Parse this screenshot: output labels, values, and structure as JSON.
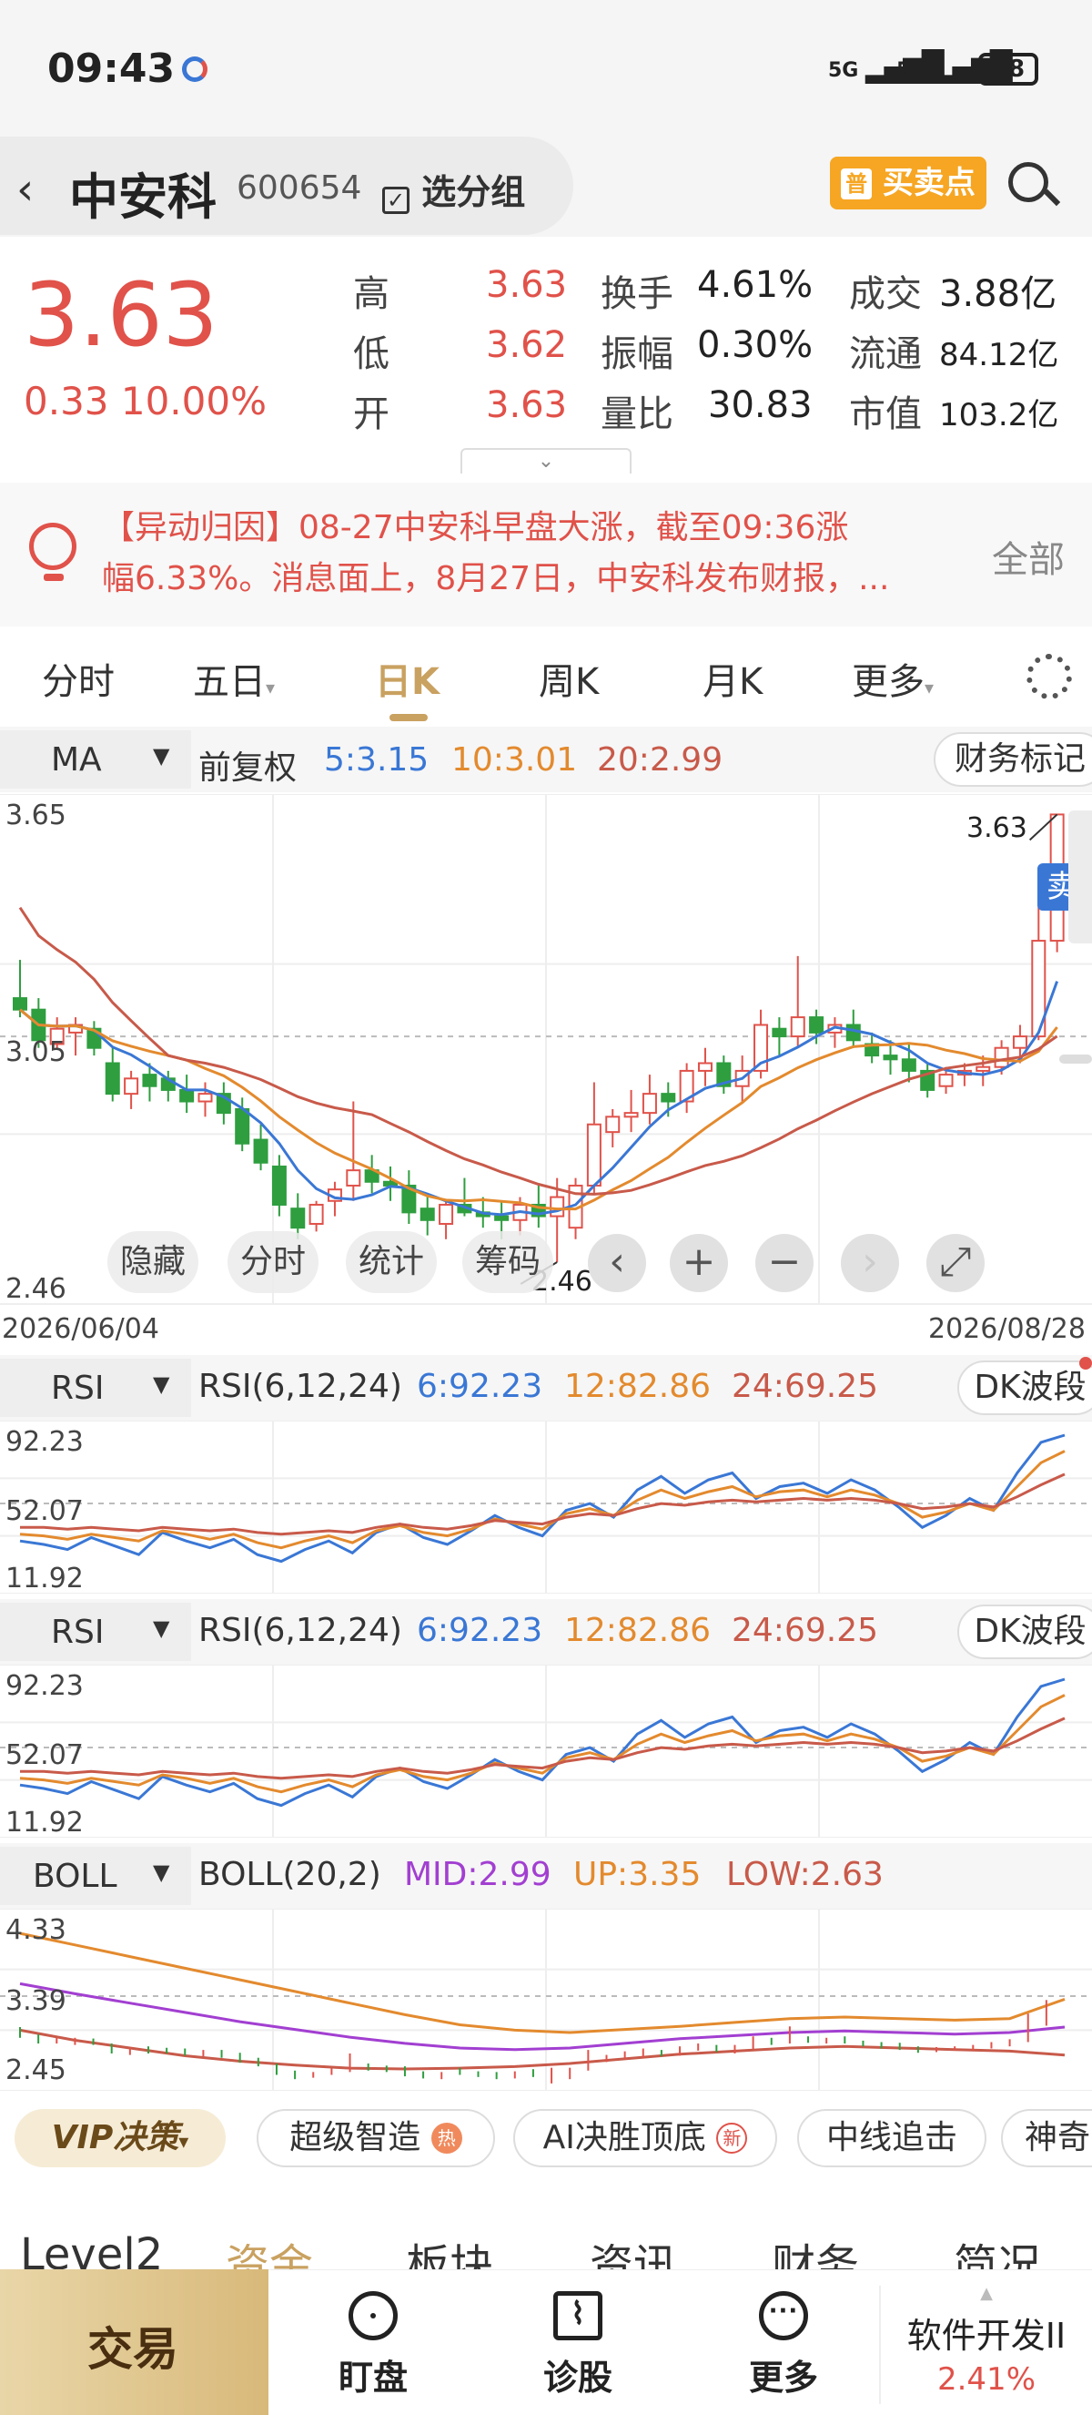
{
  "status": {
    "time": "09:43",
    "signal1": "5G",
    "signal2": "5G",
    "battery": "88"
  },
  "header": {
    "stock_name": "中安科",
    "stock_code": "600654",
    "group_button": "选分组",
    "buy_sell_button": "买卖点"
  },
  "quote": {
    "price": "3.63",
    "change": "0.33 10.00%",
    "rows": [
      {
        "l1": "高",
        "v1": "3.63",
        "l2": "换手",
        "v2": "4.61%",
        "l3": "成交",
        "v3": "3.88亿"
      },
      {
        "l1": "低",
        "v1": "3.62",
        "l2": "振幅",
        "v2": "0.30%",
        "l3": "流通",
        "v3": "84.12亿"
      },
      {
        "l1": "开",
        "v1": "3.63",
        "l2": "量比",
        "v2": "30.83",
        "l3": "市值",
        "v3": "103.2亿"
      }
    ]
  },
  "news": {
    "line1": "【异动归因】08-27中安科早盘大涨，截至09:36涨",
    "line2": "幅6.33%。消息面上，8月27日，中安科发布财报，...",
    "all": "全部"
  },
  "tabs": [
    "分时",
    "五日",
    "日K",
    "周K",
    "月K",
    "更多"
  ],
  "kline": {
    "indicator": "MA",
    "adjust": "前复权",
    "ma5": "5:3.15",
    "ma10": "10:3.01",
    "ma20": "20:2.99",
    "finance_mark": "财务标记",
    "y_top": "3.65",
    "y_mid": "3.05",
    "y_bottom": "2.46",
    "max_label": "3.63",
    "min_label": "2.46",
    "sell_tag": "卖",
    "date_start": "2026/06/04",
    "date_end": "2026/08/28",
    "overlay_buttons": [
      "隐藏",
      "分时",
      "统计",
      "筹码"
    ]
  },
  "rsi1": {
    "name": "RSI",
    "params": "RSI(6,12,24)",
    "v6": "6:92.23",
    "v12": "12:82.86",
    "v24": "24:69.25",
    "badge": "DK波段",
    "y_top": "92.23",
    "y_mid": "52.07",
    "y_bottom": "11.92"
  },
  "rsi2": {
    "name": "RSI",
    "params": "RSI(6,12,24)",
    "v6": "6:92.23",
    "v12": "12:82.86",
    "v24": "24:69.25",
    "badge": "DK波段",
    "y_top": "92.23",
    "y_mid": "52.07",
    "y_bottom": "11.92"
  },
  "boll": {
    "name": "BOLL",
    "params": "BOLL(20,2)",
    "mid": "MID:2.99",
    "up": "UP:3.35",
    "low": "LOW:2.63",
    "y_top": "4.33",
    "y_mid": "3.39",
    "y_bottom": "2.45"
  },
  "chips": {
    "vip": "VIP决策",
    "c1": "超级智造",
    "c1_badge": "热",
    "c2": "AI决胜顶底",
    "c2_badge": "新",
    "c3": "中线追击",
    "c4": "神奇"
  },
  "subtabs": [
    "Level2",
    "资金",
    "板块",
    "资讯",
    "财务",
    "简况"
  ],
  "bottom": {
    "trade": "交易",
    "watch": "盯盘",
    "diagnose": "诊股",
    "more": "更多",
    "sector_name": "软件开发II",
    "sector_change": "2.41%"
  },
  "colors": {
    "red": "#e0524a",
    "blue": "#3a77d5",
    "orange": "#e38a2e",
    "brown": "#c85a4a",
    "green": "#2e9e3f",
    "purple": "#a23fd1",
    "gold": "#d8b97a"
  },
  "chart_data": [
    {
      "type": "candlestick",
      "title": "",
      "x_range": [
        "2026/06/04",
        "2026/08/28"
      ],
      "ylim": [
        2.46,
        3.65
      ],
      "series": [
        {
          "name": "K",
          "ohlc": [
            [
              3.15,
              3.25,
              3.1,
              3.12
            ],
            [
              3.12,
              3.15,
              3.02,
              3.04
            ],
            [
              3.03,
              3.1,
              3.02,
              3.07
            ],
            [
              3.06,
              3.1,
              3.0,
              3.08
            ],
            [
              3.07,
              3.09,
              3.0,
              3.02
            ],
            [
              2.98,
              3.02,
              2.88,
              2.9
            ],
            [
              2.9,
              2.96,
              2.86,
              2.94
            ],
            [
              2.95,
              2.98,
              2.88,
              2.92
            ],
            [
              2.94,
              2.96,
              2.88,
              2.91
            ],
            [
              2.91,
              2.95,
              2.85,
              2.88
            ],
            [
              2.88,
              2.93,
              2.84,
              2.9
            ],
            [
              2.9,
              2.93,
              2.82,
              2.85
            ],
            [
              2.86,
              2.89,
              2.75,
              2.77
            ],
            [
              2.78,
              2.82,
              2.7,
              2.72
            ],
            [
              2.71,
              2.74,
              2.58,
              2.61
            ],
            [
              2.6,
              2.64,
              2.52,
              2.55
            ],
            [
              2.56,
              2.62,
              2.54,
              2.61
            ],
            [
              2.62,
              2.67,
              2.58,
              2.65
            ],
            [
              2.66,
              2.88,
              2.62,
              2.7
            ],
            [
              2.7,
              2.74,
              2.64,
              2.67
            ],
            [
              2.67,
              2.71,
              2.62,
              2.66
            ],
            [
              2.66,
              2.7,
              2.56,
              2.59
            ],
            [
              2.6,
              2.63,
              2.53,
              2.57
            ],
            [
              2.56,
              2.62,
              2.52,
              2.61
            ],
            [
              2.61,
              2.68,
              2.58,
              2.59
            ],
            [
              2.59,
              2.63,
              2.55,
              2.58
            ],
            [
              2.58,
              2.62,
              2.52,
              2.57
            ],
            [
              2.57,
              2.63,
              2.53,
              2.61
            ],
            [
              2.61,
              2.66,
              2.55,
              2.58
            ],
            [
              2.58,
              2.68,
              2.46,
              2.63
            ],
            [
              2.55,
              2.68,
              2.52,
              2.66
            ],
            [
              2.66,
              2.93,
              2.64,
              2.82
            ],
            [
              2.8,
              2.86,
              2.76,
              2.84
            ],
            [
              2.84,
              2.91,
              2.8,
              2.85
            ],
            [
              2.85,
              2.95,
              2.82,
              2.9
            ],
            [
              2.9,
              2.93,
              2.84,
              2.88
            ],
            [
              2.88,
              2.98,
              2.85,
              2.96
            ],
            [
              2.96,
              3.02,
              2.92,
              2.98
            ],
            [
              2.98,
              3.0,
              2.9,
              2.92
            ],
            [
              2.92,
              3.0,
              2.88,
              2.96
            ],
            [
              2.96,
              3.12,
              2.94,
              3.08
            ],
            [
              3.07,
              3.1,
              3.0,
              3.05
            ],
            [
              3.05,
              3.26,
              3.02,
              3.1
            ],
            [
              3.1,
              3.12,
              3.03,
              3.06
            ],
            [
              3.06,
              3.1,
              3.02,
              3.08
            ],
            [
              3.08,
              3.12,
              3.02,
              3.04
            ],
            [
              3.03,
              3.06,
              2.98,
              3.0
            ],
            [
              3.0,
              3.04,
              2.95,
              2.99
            ],
            [
              2.99,
              3.03,
              2.93,
              2.96
            ],
            [
              2.96,
              2.98,
              2.89,
              2.91
            ],
            [
              2.92,
              2.97,
              2.9,
              2.95
            ],
            [
              2.95,
              2.98,
              2.92,
              2.96
            ],
            [
              2.96,
              3.0,
              2.92,
              2.97
            ],
            [
              2.97,
              3.04,
              2.95,
              3.02
            ],
            [
              3.02,
              3.08,
              2.98,
              3.05
            ],
            [
              3.05,
              3.44,
              3.04,
              3.3
            ],
            [
              3.3,
              3.63,
              3.27,
              3.63
            ]
          ]
        },
        {
          "name": "MA5",
          "label": "5:3.15"
        },
        {
          "name": "MA10",
          "label": "10:3.01"
        },
        {
          "name": "MA20",
          "label": "20:2.99"
        }
      ]
    },
    {
      "type": "line",
      "title": "RSI(6,12,24)",
      "ylim": [
        11.92,
        92.23
      ],
      "series": [
        {
          "name": "6",
          "values": [
            30,
            28,
            25,
            32,
            27,
            22,
            35,
            30,
            26,
            31,
            22,
            18,
            25,
            30,
            23,
            35,
            40,
            32,
            28,
            36,
            45,
            38,
            33,
            48,
            52,
            44,
            60,
            68,
            58,
            66,
            70,
            55,
            62,
            64,
            58,
            66,
            60,
            50,
            38,
            45,
            55,
            48,
            70,
            88,
            92.23
          ]
        },
        {
          "name": "12",
          "values": [
            34,
            33,
            31,
            34,
            32,
            30,
            36,
            34,
            31,
            34,
            29,
            26,
            30,
            33,
            29,
            36,
            39,
            35,
            33,
            37,
            43,
            40,
            37,
            46,
            49,
            45,
            54,
            60,
            55,
            59,
            62,
            56,
            59,
            60,
            56,
            60,
            57,
            52,
            44,
            47,
            52,
            48,
            62,
            76,
            82.86
          ]
        },
        {
          "name": "24",
          "values": [
            38,
            38,
            37,
            38,
            37,
            36,
            38,
            37,
            36,
            37,
            35,
            34,
            35,
            36,
            35,
            38,
            40,
            38,
            37,
            39,
            42,
            41,
            40,
            44,
            46,
            45,
            49,
            52,
            51,
            53,
            54,
            53,
            54,
            55,
            54,
            55,
            54,
            52,
            49,
            50,
            52,
            50,
            56,
            63,
            69.25
          ]
        }
      ]
    },
    {
      "type": "line",
      "title": "RSI(6,12,24)",
      "ylim": [
        11.92,
        92.23
      ],
      "series": [
        {
          "name": "6",
          "values": [
            30,
            28,
            25,
            32,
            27,
            22,
            35,
            30,
            26,
            31,
            22,
            18,
            25,
            30,
            23,
            35,
            40,
            32,
            28,
            36,
            45,
            38,
            33,
            48,
            52,
            44,
            60,
            68,
            58,
            66,
            70,
            55,
            62,
            64,
            58,
            66,
            60,
            50,
            38,
            45,
            55,
            48,
            70,
            88,
            92.23
          ]
        },
        {
          "name": "12",
          "values": [
            34,
            33,
            31,
            34,
            32,
            30,
            36,
            34,
            31,
            34,
            29,
            26,
            30,
            33,
            29,
            36,
            39,
            35,
            33,
            37,
            43,
            40,
            37,
            46,
            49,
            45,
            54,
            60,
            55,
            59,
            62,
            56,
            59,
            60,
            56,
            60,
            57,
            52,
            44,
            47,
            52,
            48,
            62,
            76,
            82.86
          ]
        },
        {
          "name": "24",
          "values": [
            38,
            38,
            37,
            38,
            37,
            36,
            38,
            37,
            36,
            37,
            35,
            34,
            35,
            36,
            35,
            38,
            40,
            38,
            37,
            39,
            42,
            41,
            40,
            44,
            46,
            45,
            49,
            52,
            51,
            53,
            54,
            53,
            54,
            55,
            54,
            55,
            54,
            52,
            49,
            50,
            52,
            50,
            56,
            63,
            69.25
          ]
        }
      ]
    },
    {
      "type": "line",
      "title": "BOLL(20,2)",
      "ylim": [
        2.45,
        4.33
      ],
      "series": [
        {
          "name": "UP",
          "values": [
            4.2,
            4.05,
            3.9,
            3.75,
            3.6,
            3.45,
            3.3,
            3.15,
            3.02,
            2.95,
            2.92,
            2.96,
            3.0,
            3.05,
            3.1,
            3.12,
            3.1,
            3.08,
            3.1,
            3.35
          ]
        },
        {
          "name": "MID",
          "values": [
            3.55,
            3.42,
            3.3,
            3.18,
            3.06,
            2.96,
            2.86,
            2.78,
            2.72,
            2.7,
            2.72,
            2.78,
            2.84,
            2.88,
            2.92,
            2.94,
            2.92,
            2.9,
            2.92,
            2.99
          ]
        },
        {
          "name": "LOW",
          "values": [
            2.95,
            2.82,
            2.72,
            2.62,
            2.55,
            2.5,
            2.46,
            2.45,
            2.46,
            2.48,
            2.52,
            2.58,
            2.64,
            2.68,
            2.72,
            2.74,
            2.72,
            2.7,
            2.68,
            2.63
          ]
        }
      ]
    }
  ]
}
